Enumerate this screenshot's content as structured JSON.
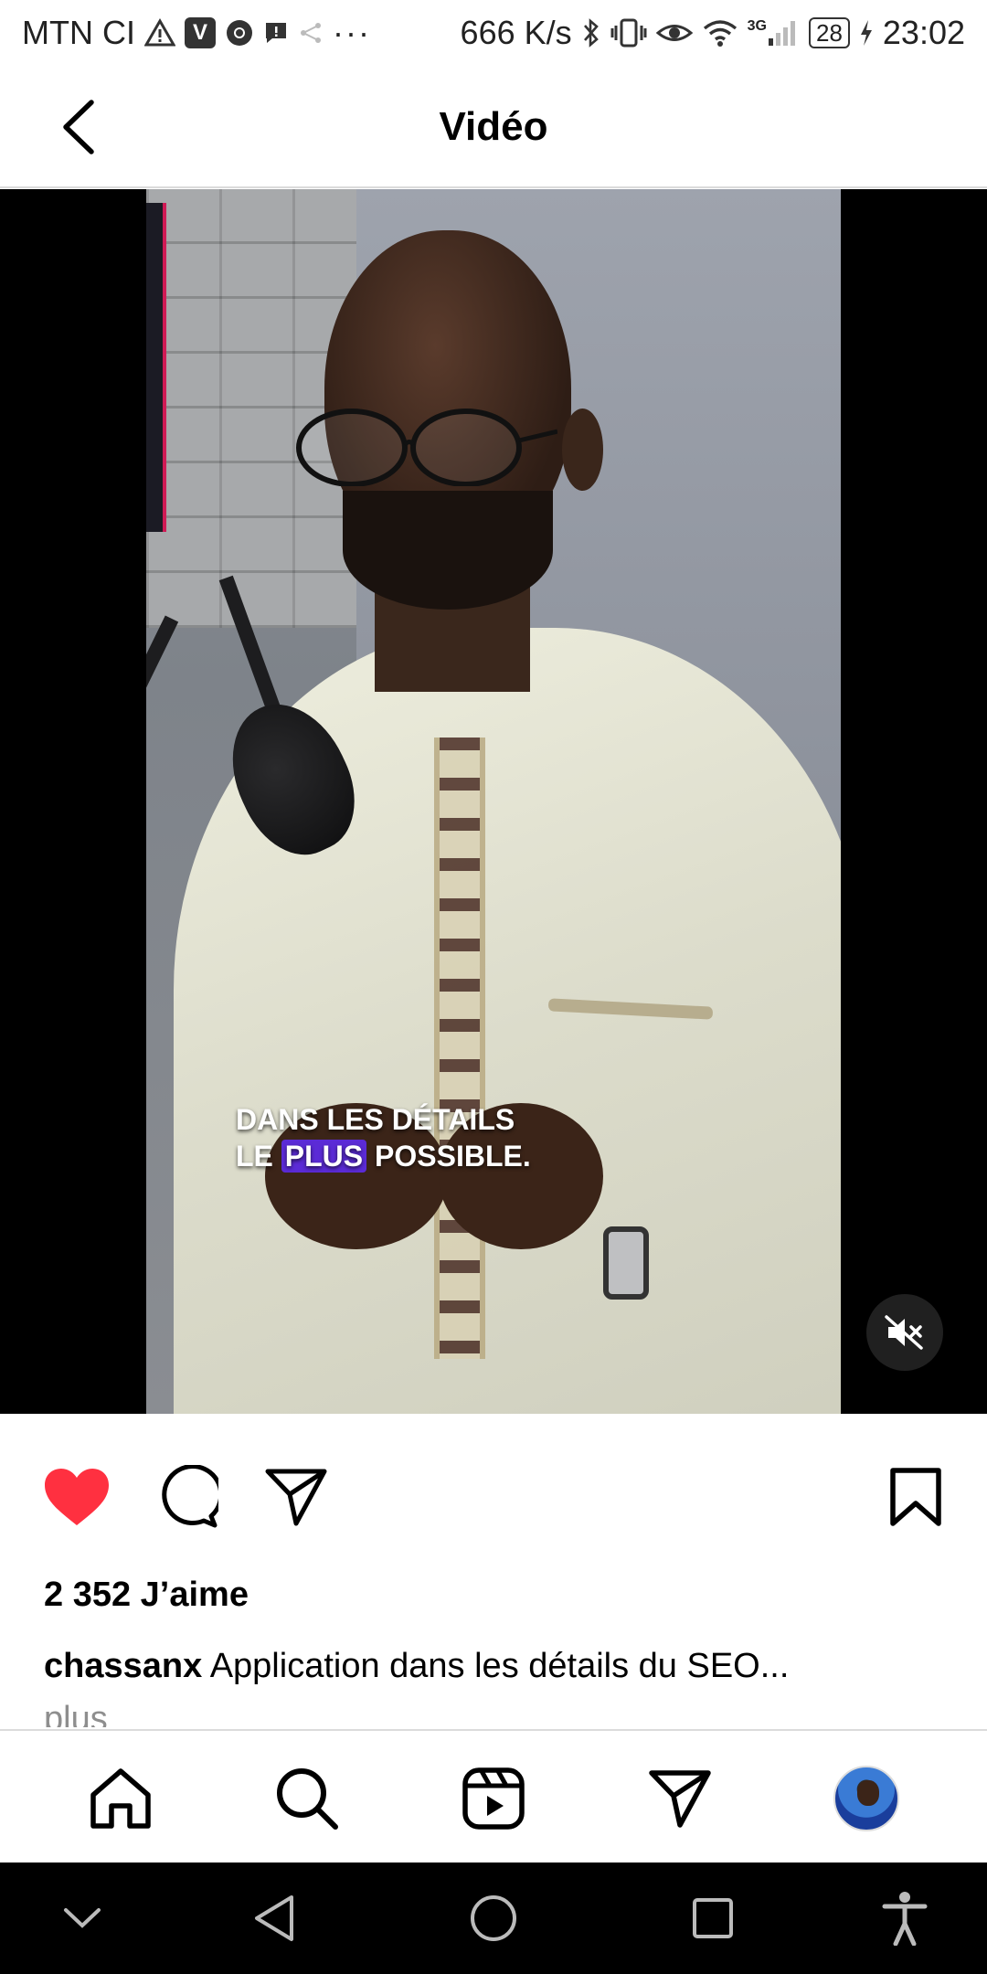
{
  "status_bar": {
    "carrier": "MTN CI",
    "speed": "666 K/s",
    "network": "3G",
    "battery": "28",
    "time": "23:02",
    "more_dots": "···"
  },
  "header": {
    "title": "Vidéo"
  },
  "video": {
    "caption_line1": "DANS LES DÉTAILS",
    "caption_line2_pre": "LE ",
    "caption_line2_highlight": "PLUS",
    "caption_line2_post": " POSSIBLE.",
    "highlight_color": "#5b2bd6"
  },
  "post": {
    "likes": "2 352 J’aime",
    "username": "chassanx",
    "caption": " Application dans les détails du SEO...",
    "more": "plus",
    "liked": true,
    "like_color": "#ff3040"
  },
  "icons": {
    "back": "chevron-left-icon",
    "mute": "speaker-muted-icon",
    "like": "heart-icon",
    "comment": "comment-icon",
    "share": "send-icon",
    "save": "bookmark-icon",
    "home": "home-icon",
    "search": "search-icon",
    "reels": "reels-icon",
    "messages": "send-icon",
    "profile": "avatar"
  }
}
